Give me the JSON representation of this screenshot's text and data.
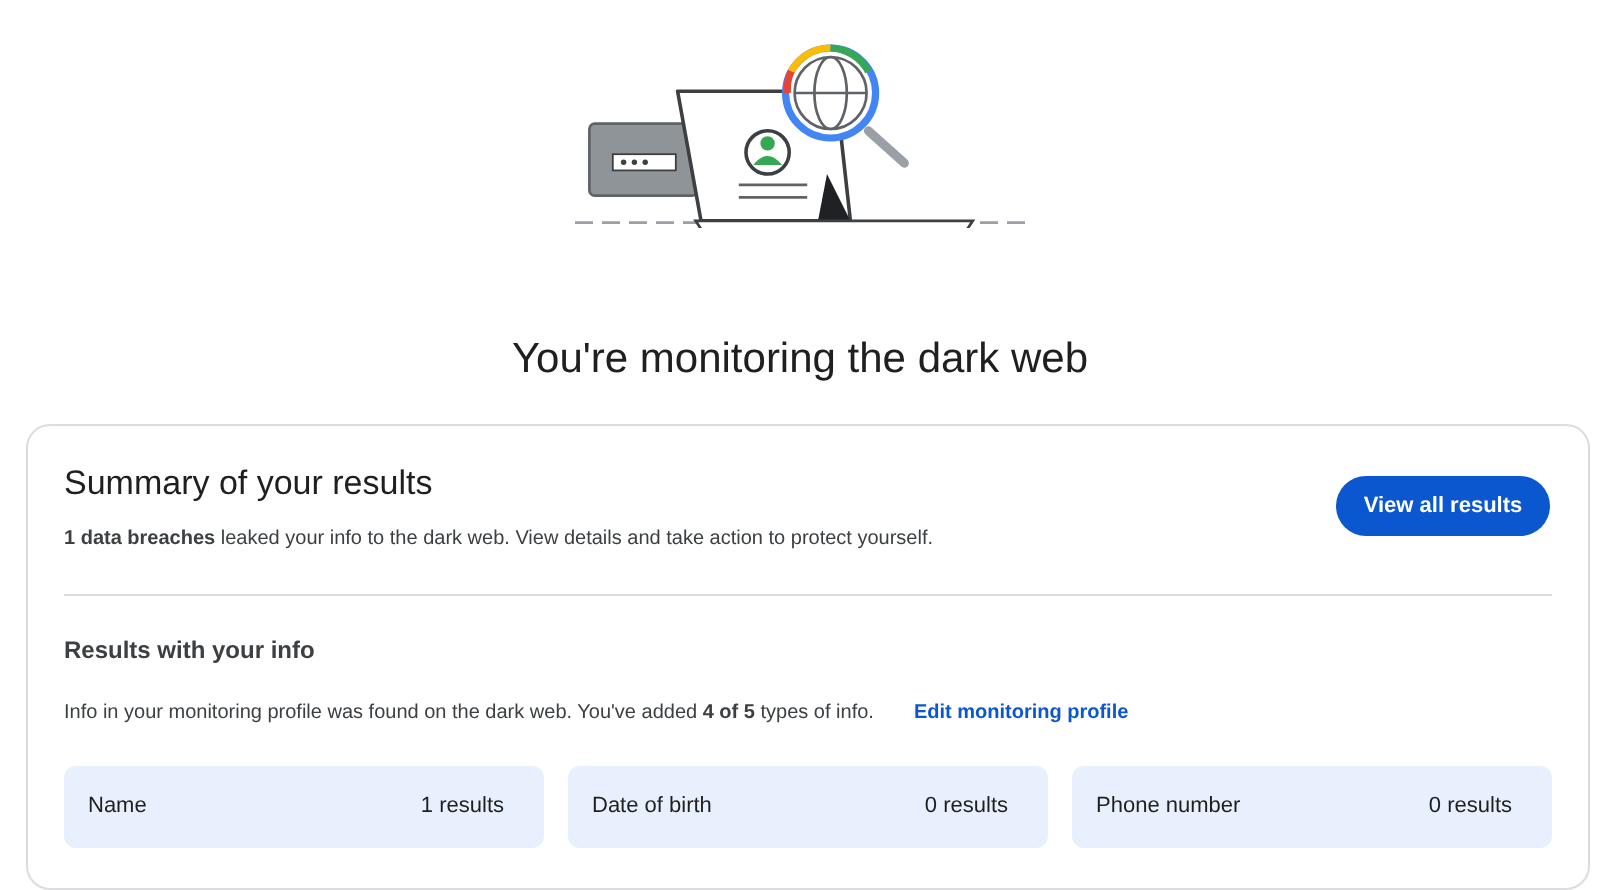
{
  "page_title": "You're monitoring the dark web",
  "summary": {
    "title": "Summary of your results",
    "description": "**1 data breaches** leaked your info to the dark web. View details and take action to protect yourself.",
    "button": "View all results"
  },
  "results": {
    "title": "Results with your info",
    "description": "Info in your monitoring profile was found on the dark web. You've added **4 of 5** types of info.",
    "link": "Edit monitoring profile",
    "items": [
      {
        "label": "Name",
        "count": "1 results"
      },
      {
        "label": "Date of birth",
        "count": "0 results"
      },
      {
        "label": "Phone number",
        "count": "0 results"
      }
    ]
  }
}
